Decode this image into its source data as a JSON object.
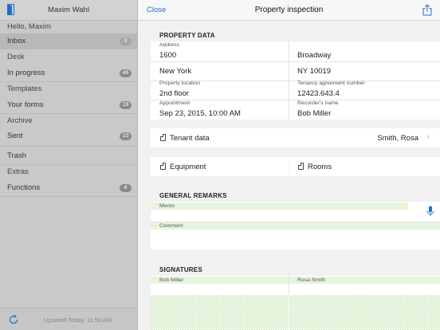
{
  "sidebar": {
    "user_name": "Maxim Wahl",
    "greeting": "Hello, Maxim",
    "items": [
      {
        "label": "Inbox",
        "badge": "3",
        "type": "item"
      },
      {
        "label": "Desk",
        "badge": "",
        "type": "section"
      },
      {
        "label": "In progress",
        "badge": "46",
        "type": "item"
      },
      {
        "label": "Templates",
        "badge": "",
        "type": "section"
      },
      {
        "label": "Your forms",
        "badge": "18",
        "type": "item"
      },
      {
        "label": "Archive",
        "badge": "",
        "type": "section"
      },
      {
        "label": "Sent",
        "badge": "10",
        "type": "item"
      },
      {
        "label": "Trash",
        "badge": "",
        "type": "item"
      },
      {
        "label": "Extras",
        "badge": "",
        "type": "section"
      },
      {
        "label": "Functions",
        "badge": "4",
        "type": "item"
      }
    ],
    "updated_text": "Updated Today, 11:50 AM"
  },
  "navbar": {
    "close_label": "Close",
    "title": "Property inspection"
  },
  "property_data": {
    "section_title": "PROPERTY DATA",
    "address_label": "Address",
    "street_number": "1600",
    "street_name": "Broadway",
    "city": "New York",
    "state_zip": "NY 10019",
    "location_label": "Property location",
    "location_value": "2nd floor",
    "tenancy_label": "Tenancy agreement number",
    "tenancy_value": "12423.643.4",
    "appointment_label": "Appointment",
    "appointment_value": "Sep 23, 2015, 10:00 AM",
    "recorder_label": "Recorder's name",
    "recorder_value": "Bob Miller"
  },
  "tenant": {
    "label": "Tenant data",
    "value": "Smith, Rosa"
  },
  "equipment_label": "Equipment",
  "rooms_label": "Rooms",
  "general_remarks": {
    "section_title": "GENERAL REMARKS",
    "memo_label": "Memo",
    "comment_label": "Comment"
  },
  "signatures": {
    "section_title": "SIGNATURES",
    "signer1": "Bob Miller",
    "signer2": "Rosa Smith"
  },
  "colors": {
    "accent": "#1f6fd1",
    "field_highlight": "#e7f4de"
  }
}
